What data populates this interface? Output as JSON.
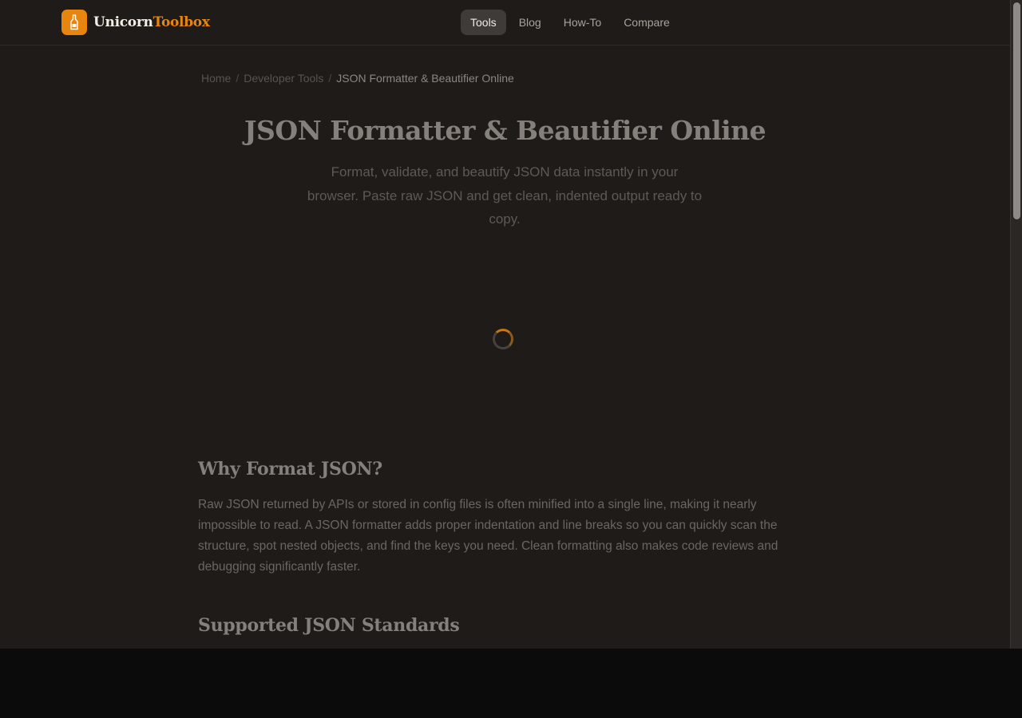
{
  "brand": {
    "name_part1": "Unicorn",
    "name_part2": "Toolbox",
    "accent_color": "#e8850f",
    "icon": "bottle-icon"
  },
  "nav": {
    "items": [
      {
        "label": "Tools",
        "active": true
      },
      {
        "label": "Blog",
        "active": false
      },
      {
        "label": "How-To",
        "active": false
      },
      {
        "label": "Compare",
        "active": false
      }
    ]
  },
  "breadcrumb": {
    "items": [
      "Home",
      "Developer Tools"
    ],
    "separator": "/",
    "current": "JSON Formatter & Beautifier Online"
  },
  "page": {
    "title": "JSON Formatter & Beautifier Online",
    "subtitle": "Format, validate, and beautify JSON data instantly in your browser. Paste raw JSON and get clean, indented output ready to copy."
  },
  "loading": {
    "icon": "loading-spinner-icon"
  },
  "sections": [
    {
      "title": "Why Format JSON?",
      "body": "Raw JSON returned by APIs or stored in config files is often minified into a single line, making it nearly impossible to read. A JSON formatter adds proper indentation and line breaks so you can quickly scan the structure, spot nested objects, and find the keys you need. Clean formatting also makes code reviews and debugging significantly faster."
    },
    {
      "title": "Supported JSON Standards"
    }
  ]
}
